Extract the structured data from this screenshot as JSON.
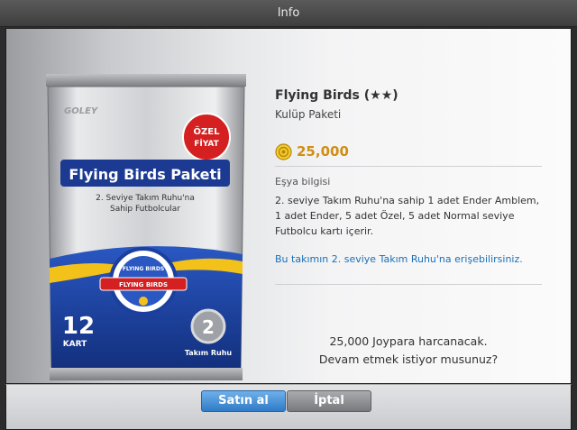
{
  "window": {
    "title": "Info"
  },
  "item": {
    "name": "Flying Birds (★★)",
    "category": "Kulüp Paketi",
    "price": "25,000"
  },
  "details": {
    "heading": "Eşya bilgisi",
    "description": "2. seviye Takım Ruhu'na sahip 1 adet Ender Amblem, 1 adet Ender, 5 adet Özel, 5 adet Normal seviye Futbolcu kartı içerir.",
    "access_note": "Bu takımın 2. seviye Takım Ruhu'na erişebilirsiniz."
  },
  "confirmation": {
    "line1": "25,000 Joypara harcanacak.",
    "line2": "Devam etmek istiyor musunuz?"
  },
  "pack": {
    "brand": "GOLEY",
    "badge_line1": "ÖZEL",
    "badge_line2": "FİYAT",
    "title": "Flying Birds Paketi",
    "subtitle_line1": "2. Seviye Takım Ruhu'na",
    "subtitle_line2": "Sahip Futbolcular",
    "emblem_top": "FLYING BIRDS",
    "emblem_band": "FLYING BIRDS",
    "card_count": "12",
    "card_unit": "KART",
    "spirit_level": "2",
    "spirit_label": "Takım Ruhu"
  },
  "buttons": {
    "buy": "Satın al",
    "cancel": "İptal"
  },
  "colors": {
    "price": "#d08e12",
    "link": "#1a6fb8",
    "primary_button": "#2f7bc7",
    "pack_blue": "#1b3f9e",
    "badge_red": "#d42020"
  }
}
